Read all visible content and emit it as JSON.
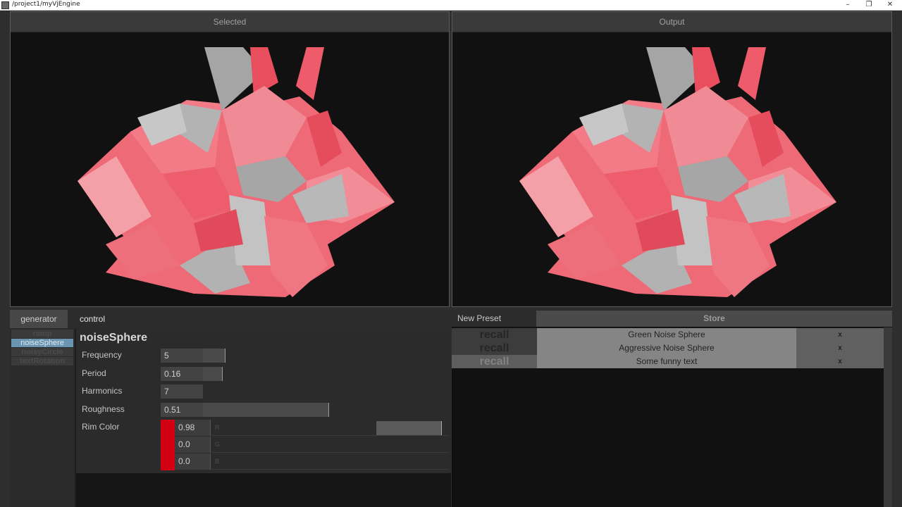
{
  "window": {
    "title": "/project1/myVjEngine",
    "buttons": {
      "minimize": "–",
      "restore": "❐",
      "close": "✕"
    }
  },
  "viewports": {
    "selected": {
      "label": "Selected"
    },
    "output": {
      "label": "Output"
    }
  },
  "tabs": {
    "generator": "generator",
    "control": "control"
  },
  "generators": {
    "items": [
      {
        "label": "ramp",
        "selected": false
      },
      {
        "label": "noiseSphere",
        "selected": true
      },
      {
        "label": "noisyCircle",
        "selected": false
      },
      {
        "label": "textRotation",
        "selected": false
      }
    ]
  },
  "control": {
    "title": "noiseSphere",
    "params": [
      {
        "label": "Frequency",
        "value": "5",
        "level": 0.09
      },
      {
        "label": "Period",
        "value": "0.16",
        "level": 0.08
      },
      {
        "label": "Harmonics",
        "value": "7",
        "level": 0.0
      },
      {
        "label": "Roughness",
        "value": "0.51",
        "level": 0.51
      }
    ],
    "rim_color": {
      "label": "Rim Color",
      "swatch": "#d10012",
      "channels": [
        {
          "name": "R",
          "value": "0.98",
          "level": 0.98
        },
        {
          "name": "G",
          "value": "0.0",
          "level": 0.0
        },
        {
          "name": "B",
          "value": "0.0",
          "level": 0.0
        }
      ]
    }
  },
  "presets": {
    "new_preset_label": "New Preset",
    "store_label": "Store",
    "recall_label": "recall",
    "delete_label": "x",
    "items": [
      {
        "name": "Green Noise Sphere"
      },
      {
        "name": "Aggressive Noise Sphere"
      },
      {
        "name": "Some funny text"
      }
    ]
  },
  "colors": {
    "accent_selected": "#6a95b0",
    "rim_red": "#d10012",
    "mesh_pink": "#ef5f6d",
    "mesh_gray": "#9a9a9a"
  }
}
